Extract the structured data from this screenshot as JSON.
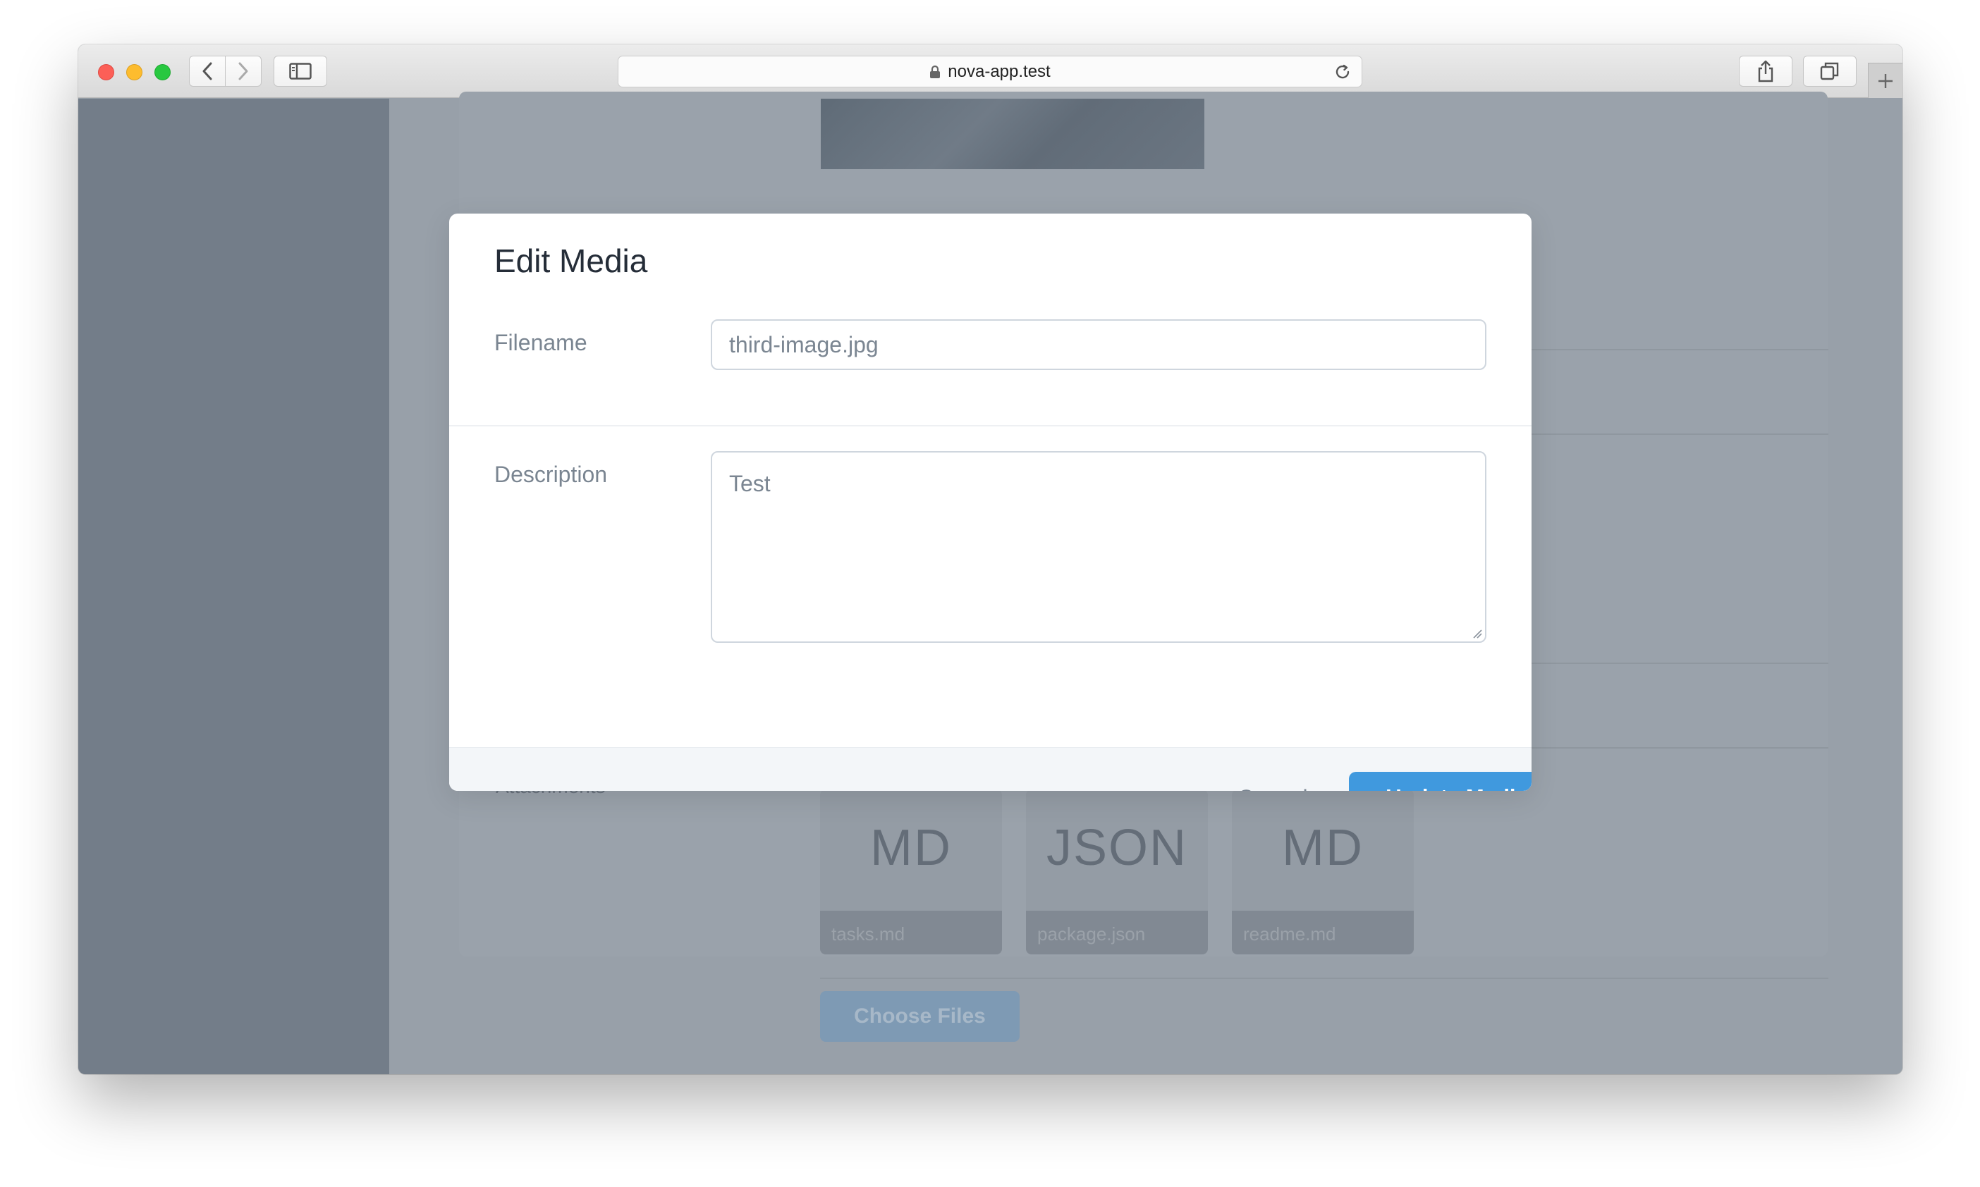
{
  "browser": {
    "url": "nova-app.test"
  },
  "modal": {
    "title": "Edit Media",
    "filename_label": "Filename",
    "filename_value": "third-image.jpg",
    "description_label": "Description",
    "description_value": "Test",
    "cancel_label": "Cancel",
    "submit_label": "Update Media"
  },
  "background": {
    "attachments_label": "Attachments",
    "files": [
      {
        "type": "MD",
        "name": "tasks.md"
      },
      {
        "type": "JSON",
        "name": "package.json"
      },
      {
        "type": "MD",
        "name": "readme.md"
      }
    ],
    "choose_files_label": "Choose Files"
  },
  "icons": {
    "back": "chevron-left-icon",
    "forward": "chevron-right-icon",
    "sidebar": "sidebar-icon",
    "lock": "lock-icon",
    "reload": "reload-icon",
    "share": "share-icon",
    "tabs": "tabs-icon",
    "new_tab": "plus-icon"
  },
  "colors": {
    "primary": "#4099de",
    "overlay": "#98a0a9",
    "title_text": "#252d38"
  }
}
